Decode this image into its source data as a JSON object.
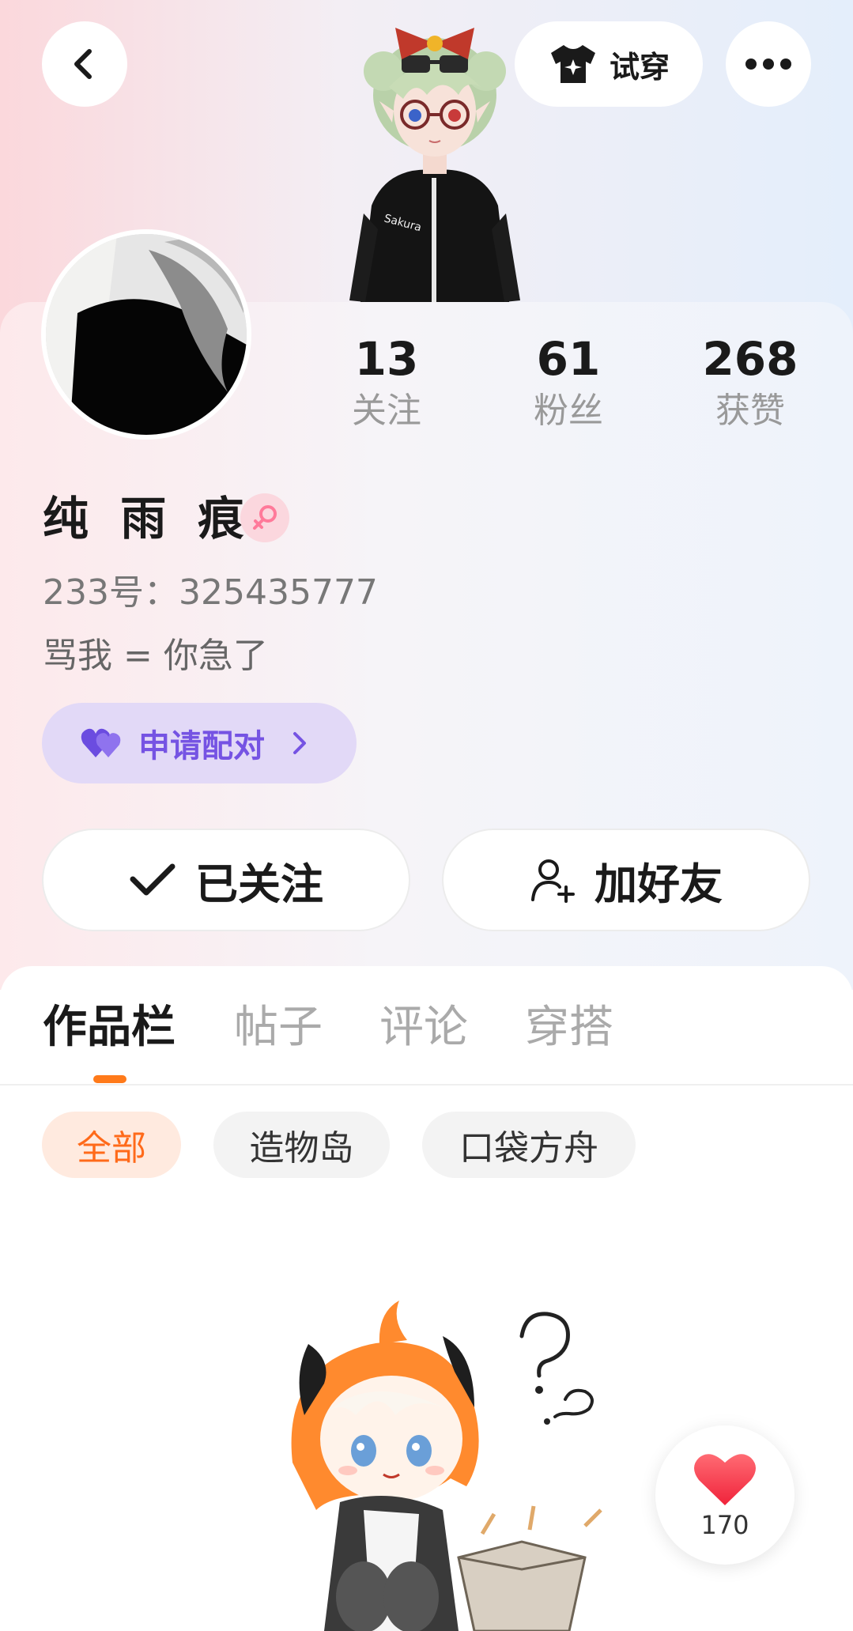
{
  "header": {
    "tryon_label": "试穿"
  },
  "stats": [
    {
      "value": "13",
      "label": "关注"
    },
    {
      "value": "61",
      "label": "粉丝"
    },
    {
      "value": "268",
      "label": "获赞"
    }
  ],
  "profile": {
    "name": "纯 雨 痕.",
    "uid": "233号：325435777",
    "bio": "骂我 = 你急了",
    "gender_icon": "female-icon"
  },
  "pair_button": {
    "label": "申请配对"
  },
  "actions": {
    "follow_label": "已关注",
    "add_friend_label": "加好友"
  },
  "tabs": [
    {
      "label": "作品栏",
      "active": true
    },
    {
      "label": "帖子",
      "active": false
    },
    {
      "label": "评论",
      "active": false
    },
    {
      "label": "穿搭",
      "active": false
    }
  ],
  "filters": [
    {
      "label": "全部",
      "active": true
    },
    {
      "label": "造物岛",
      "active": false
    },
    {
      "label": "口袋方舟",
      "active": false
    }
  ],
  "like_float": {
    "count": "170"
  },
  "colors": {
    "accent_orange": "#ff7a1a",
    "pair_purple": "#7553e3",
    "like_red": "#ff4d5a"
  }
}
